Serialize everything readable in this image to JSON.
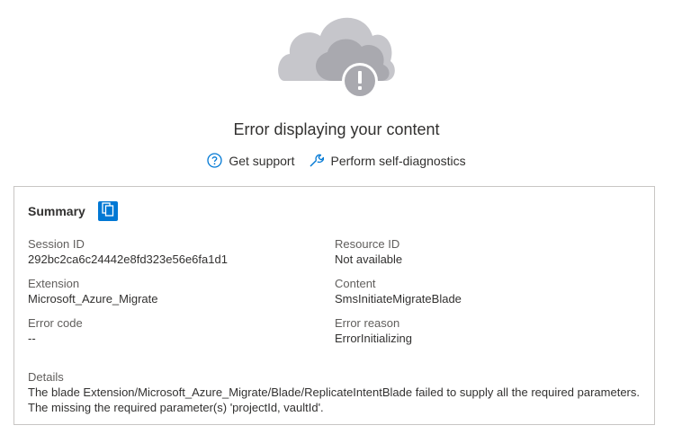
{
  "error": {
    "title": "Error displaying your content",
    "icon": "cloud-error-icon"
  },
  "links": [
    {
      "label": "Get support",
      "icon": "question-circle-icon"
    },
    {
      "label": "Perform self-diagnostics",
      "icon": "wrench-icon"
    }
  ],
  "summary": {
    "label": "Summary",
    "copy_icon": "copy-icon",
    "fields": {
      "session_id": {
        "label": "Session ID",
        "value": "292bc2ca6c24442e8fd323e56e6fa1d1"
      },
      "resource_id": {
        "label": "Resource ID",
        "value": "Not available"
      },
      "extension": {
        "label": "Extension",
        "value": "Microsoft_Azure_Migrate"
      },
      "content": {
        "label": "Content",
        "value": "SmsInitiateMigrateBlade"
      },
      "error_code": {
        "label": "Error code",
        "value": "--"
      },
      "error_reason": {
        "label": "Error reason",
        "value": "ErrorInitializing"
      }
    },
    "details": {
      "label": "Details",
      "value": "The blade Extension/Microsoft_Azure_Migrate/Blade/ReplicateIntentBlade failed to supply all the required parameters. The missing the required parameter(s) 'projectId, vaultId'."
    }
  },
  "colors": {
    "accent": "#0078d4",
    "cloud": "#c8c8cc",
    "border": "#c8c6c4"
  }
}
